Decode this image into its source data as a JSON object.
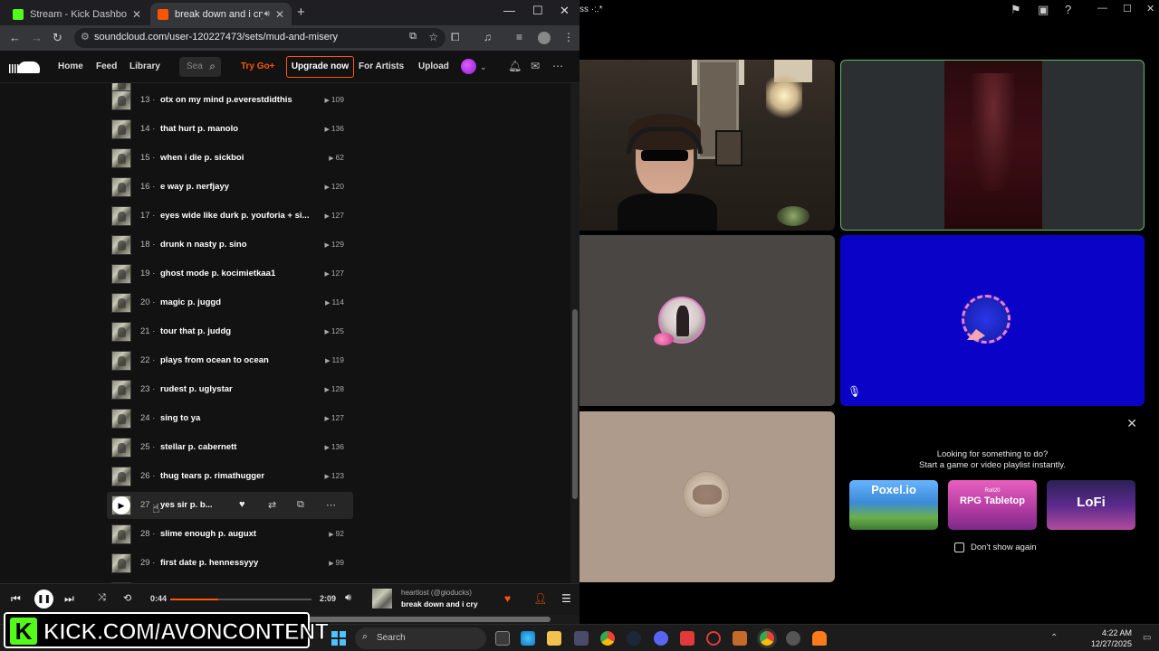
{
  "browser": {
    "tabs": [
      {
        "title": "Stream - Kick Dashboard",
        "active": false,
        "favicon_color": "#53fc18"
      },
      {
        "title": "break down and i cry in Mu",
        "active": true,
        "favicon_color": "#ff5500"
      }
    ],
    "url": "soundcloud.com/user-120227473/sets/mud-and-misery"
  },
  "soundcloud": {
    "nav": {
      "home": "Home",
      "feed": "Feed",
      "library": "Library"
    },
    "search_placeholder": "Sea",
    "try_go": "Try Go+",
    "upgrade": "Upgrade now",
    "for_artists": "For Artists",
    "upload": "Upload",
    "tracks": [
      {
        "num": "13",
        "title": "otx on my mind p.everestdidthis",
        "plays": "109"
      },
      {
        "num": "14",
        "title": "that hurt p. manolo",
        "plays": "136"
      },
      {
        "num": "15",
        "title": "when i die p. sickboi",
        "plays": "62"
      },
      {
        "num": "16",
        "title": "e way p. nerfjayy",
        "plays": "120"
      },
      {
        "num": "17",
        "title": "eyes wide like durk p. youforia + si...",
        "plays": "127"
      },
      {
        "num": "18",
        "title": "drunk n nasty p. sino",
        "plays": "129"
      },
      {
        "num": "19",
        "title": "ghost mode p. kocimietkaa1",
        "plays": "127"
      },
      {
        "num": "20",
        "title": "magic p. juggd",
        "plays": "114"
      },
      {
        "num": "21",
        "title": "tour that p. juddg",
        "plays": "125"
      },
      {
        "num": "22",
        "title": "plays from ocean to ocean",
        "plays": "119"
      },
      {
        "num": "23",
        "title": "rudest p. uglystar",
        "plays": "128"
      },
      {
        "num": "24",
        "title": "sing to ya",
        "plays": "127"
      },
      {
        "num": "25",
        "title": "stellar p. cabernett",
        "plays": "136"
      },
      {
        "num": "26",
        "title": "thug tears p. rimathugger",
        "plays": "123"
      },
      {
        "num": "27",
        "title": "yes sir p. b...",
        "plays": ""
      },
      {
        "num": "28",
        "title": "slime enough p. auguxt",
        "plays": "92"
      },
      {
        "num": "29",
        "title": "first date p. hennessyyy",
        "plays": "99"
      }
    ],
    "player": {
      "elapsed": "0:44",
      "duration": "2:09",
      "progress": 0.34,
      "artist": "heartlost (@gioducks)",
      "title": "break down and i cry"
    }
  },
  "discord": {
    "window_title": "ss ·:.*",
    "activity": {
      "heading_line1": "Looking for something to do?",
      "heading_line2": "Start a game or video playlist instantly.",
      "cards": [
        {
          "label": "Poxel.io",
          "sub": ""
        },
        {
          "label": "RPG Tabletop",
          "sub": "Roll20"
        },
        {
          "label": "LoFi",
          "sub": ""
        }
      ],
      "dont_show": "Don't show again"
    }
  },
  "overlay": {
    "kick_url": "KICK.COM/AVONCONTENT",
    "kick_letter": "K"
  },
  "taskbar": {
    "search": "Search",
    "time": "4:22 AM",
    "date": "12/27/2025"
  }
}
